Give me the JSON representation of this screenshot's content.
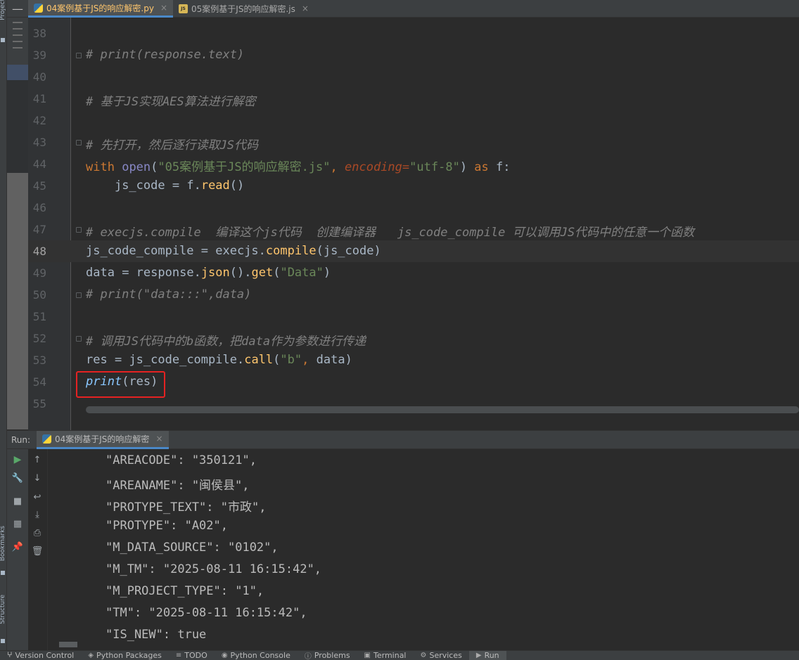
{
  "tabs": {
    "collapse_glyph": "—",
    "items": [
      {
        "label": "04案例基于JS的响应解密.py",
        "close": "×"
      },
      {
        "label": "05案例基于JS的响应解密.js",
        "close": "×"
      }
    ]
  },
  "side": {
    "project": "Project",
    "bookmarks": "Bookmarks",
    "structure": "Structure"
  },
  "editor": {
    "lines": [
      {
        "num": "38"
      },
      {
        "num": "39",
        "comment": "# print(response.text)"
      },
      {
        "num": "40"
      },
      {
        "num": "41",
        "comment": "# 基于JS实现AES算法进行解密"
      },
      {
        "num": "42"
      },
      {
        "num": "43",
        "comment": "# 先打开，然后逐行读取JS代码"
      },
      {
        "num": "44",
        "t_with": "with",
        "t_open": "open",
        "t_paren1": "(",
        "t_str1": "\"05案例基于JS的响应解密.js\"",
        "t_comma": ", ",
        "t_param": "encoding",
        "t_eq": "=",
        "t_str2": "\"utf-8\"",
        "t_paren2": ")",
        "t_as": " as ",
        "t_f": "f:"
      },
      {
        "num": "45",
        "t_indent": "    ",
        "t_var": "js_code",
        "t_assign": " = ",
        "t_obj": "f",
        "t_dot": ".",
        "t_meth": "read",
        "t_call": "()"
      },
      {
        "num": "46"
      },
      {
        "num": "47",
        "comment": "# execjs.compile  编译这个js代码  创建编译器   js_code_compile 可以调用JS代码中的任意一个函数"
      },
      {
        "num": "48",
        "t_var": "js_code_compile",
        "t_assign": " = ",
        "t_obj": "execjs",
        "t_dot": ".",
        "t_meth": "compile",
        "t_open": "(",
        "t_arg": "js_code",
        "t_close": ")"
      },
      {
        "num": "49",
        "t_var": "data",
        "t_assign": " = ",
        "t_obj": "response",
        "t_dot": ".",
        "t_meth": "json",
        "t_mid": "().",
        "t_meth2": "get",
        "t_open": "(",
        "t_str": "\"Data\"",
        "t_close": ")"
      },
      {
        "num": "50",
        "comment": "# print(\"data:::\",data)"
      },
      {
        "num": "51"
      },
      {
        "num": "52",
        "comment": "# 调用JS代码中的b函数，把data作为参数进行传递"
      },
      {
        "num": "53",
        "t_var": "res",
        "t_assign": " = ",
        "t_obj": "js_code_compile",
        "t_dot": ".",
        "t_meth": "call",
        "t_open": "(",
        "t_str": "\"b\"",
        "t_comma": ", ",
        "t_arg": "data",
        "t_close": ")"
      },
      {
        "num": "54",
        "t_print": "print",
        "t_open": "(",
        "t_arg": "res",
        "t_close": ")"
      },
      {
        "num": "55"
      }
    ]
  },
  "run": {
    "label": "Run:",
    "tab_label": "04案例基于JS的响应解密",
    "tab_close": "×",
    "console_lines": [
      "\"AREACODE\": \"350121\",",
      "\"AREANAME\": \"闽侯县\",",
      "\"PROTYPE_TEXT\": \"市政\",",
      "\"PROTYPE\": \"A02\",",
      "\"M_DATA_SOURCE\": \"0102\",",
      "\"M_TM\": \"2025-08-11 16:15:42\",",
      "\"M_PROJECT_TYPE\": \"1\",",
      "\"TM\": \"2025-08-11 16:15:42\",",
      "\"IS_NEW\": true"
    ]
  },
  "statusbar": {
    "items": [
      {
        "icon": "ⵖ",
        "label": "Version Control"
      },
      {
        "icon": "◈",
        "label": "Python Packages"
      },
      {
        "icon": "≡",
        "label": "TODO"
      },
      {
        "icon": "◉",
        "label": "Python Console"
      },
      {
        "icon": "ⓘ",
        "label": "Problems"
      },
      {
        "icon": "▣",
        "label": "Terminal"
      },
      {
        "icon": "⚙",
        "label": "Services"
      },
      {
        "icon": "▶",
        "label": "Run"
      }
    ]
  },
  "colors": {
    "accent": "#4a88c7",
    "highlight_box": "#e52222",
    "run_play": "#59a869"
  }
}
